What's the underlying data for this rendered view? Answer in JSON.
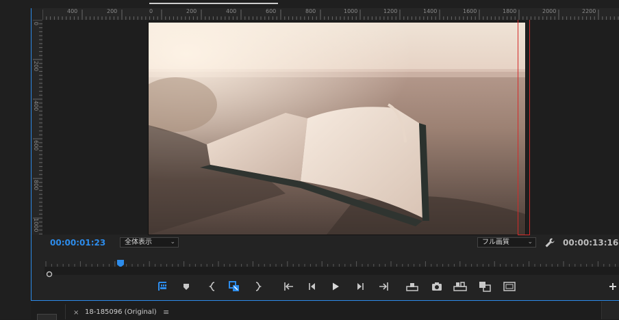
{
  "ruler": {
    "h_labels": [
      "400",
      "200",
      "0",
      "200",
      "400",
      "600",
      "800",
      "1000",
      "1200",
      "1400",
      "1600",
      "1800",
      "2000",
      "2200"
    ],
    "v_labels": [
      "0",
      "200",
      "400",
      "600",
      "800",
      "1000"
    ]
  },
  "monitor": {
    "timecode_current": "00:00:01:23",
    "timecode_duration": "00:00:13:16",
    "zoom_select": "全体表示",
    "quality_select": "フル画質"
  },
  "controls": {
    "icons": [
      "marker-in-icon",
      "add-marker-icon",
      "mark-in-icon",
      "go-to-in-icon",
      "mark-out-icon",
      "step-to-in-icon",
      "step-back-icon",
      "play-icon",
      "step-forward-icon",
      "step-to-out-icon",
      "lift-icon",
      "export-frame-icon",
      "extract-icon",
      "compare-icon",
      "safe-margins-icon",
      "add-button-icon"
    ]
  },
  "bottom_tab": {
    "close": "×",
    "title": "18-185096 (Original)",
    "menu": "≡"
  },
  "colors": {
    "accent": "#2d8ceb",
    "safe_margin": "#d42a2a"
  }
}
